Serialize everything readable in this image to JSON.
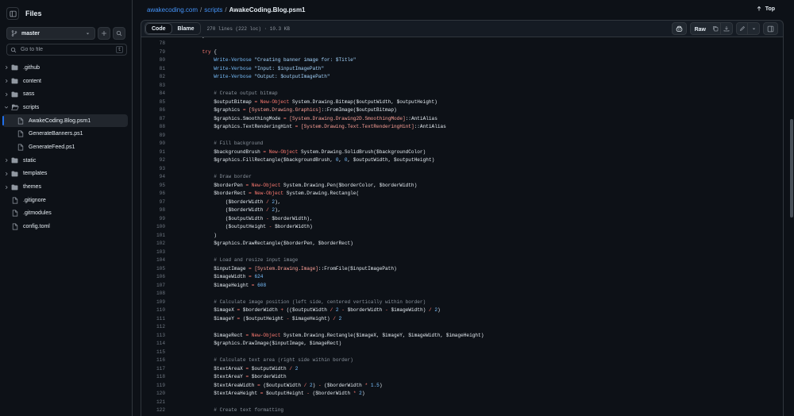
{
  "sidebar": {
    "title": "Files",
    "branch": "master",
    "search_placeholder": "Go to file",
    "search_shortcut": "t",
    "items": [
      {
        "label": ".github",
        "type": "folder"
      },
      {
        "label": "content",
        "type": "folder"
      },
      {
        "label": "sass",
        "type": "folder"
      },
      {
        "label": "scripts",
        "type": "folder-open"
      },
      {
        "label": "AwakeCoding.Blog.psm1",
        "type": "file-child",
        "active": true
      },
      {
        "label": "GenerateBanners.ps1",
        "type": "file-child"
      },
      {
        "label": "GenerateFeed.ps1",
        "type": "file-child"
      },
      {
        "label": "static",
        "type": "folder"
      },
      {
        "label": "templates",
        "type": "folder"
      },
      {
        "label": "themes",
        "type": "folder"
      },
      {
        "label": ".gitignore",
        "type": "file"
      },
      {
        "label": ".gitmodules",
        "type": "file"
      },
      {
        "label": "config.toml",
        "type": "file"
      }
    ]
  },
  "breadcrumb": {
    "repo": "awakecoding.com",
    "sep": "/",
    "folder": "scripts",
    "file": "AwakeCoding.Blog.psm1"
  },
  "top_label": "Top",
  "file_header": {
    "tabs": [
      "Code",
      "Blame"
    ],
    "meta": "270 lines (222 loc) · 10.3 KB",
    "raw_label": "Raw"
  },
  "code": {
    "first_line_number": 77,
    "lines": [
      [
        [
          "",
          "    }"
        ]
      ],
      [
        [
          "",
          ""
        ]
      ],
      [
        [
          "k",
          "    try "
        ],
        [
          "",
          "{"
        ]
      ],
      [
        [
          "f",
          "        Write-Verbose "
        ],
        [
          "s",
          "\"Creating banner image for: $Title\""
        ]
      ],
      [
        [
          "f",
          "        Write-Verbose "
        ],
        [
          "s",
          "\"Input: $inputImagePath\""
        ]
      ],
      [
        [
          "f",
          "        Write-Verbose "
        ],
        [
          "s",
          "\"Output: $outputImagePath\""
        ]
      ],
      [
        [
          "",
          ""
        ]
      ],
      [
        [
          "c",
          "        # Create output bitmap"
        ]
      ],
      [
        [
          "",
          "        $outputBitmap "
        ],
        [
          "k",
          "= New-Object "
        ],
        [
          "",
          "System.Drawing.Bitmap($outputWidth, $outputHeight)"
        ]
      ],
      [
        [
          "",
          "        $graphics "
        ],
        [
          "k",
          "= "
        ],
        [
          "t",
          "[System.Drawing.Graphics]"
        ],
        [
          "",
          "::FromImage($outputBitmap)"
        ]
      ],
      [
        [
          "",
          "        $graphics.SmoothingMode "
        ],
        [
          "k",
          "= "
        ],
        [
          "t",
          "[System.Drawing.Drawing2D.SmoothingMode]"
        ],
        [
          "",
          "::AntiAlias"
        ]
      ],
      [
        [
          "",
          "        $graphics.TextRenderingHint "
        ],
        [
          "k",
          "= "
        ],
        [
          "t",
          "[System.Drawing.Text.TextRenderingHint]"
        ],
        [
          "",
          "::AntiAlias"
        ]
      ],
      [
        [
          "",
          ""
        ]
      ],
      [
        [
          "c",
          "        # Fill background"
        ]
      ],
      [
        [
          "",
          "        $backgroundBrush "
        ],
        [
          "k",
          "= New-Object "
        ],
        [
          "",
          "System.Drawing.SolidBrush($backgroundColor)"
        ]
      ],
      [
        [
          "",
          "        $graphics.FillRectangle($backgroundBrush, "
        ],
        [
          "n",
          "0"
        ],
        [
          "",
          ", "
        ],
        [
          "n",
          "0"
        ],
        [
          "",
          ", $outputWidth, $outputHeight)"
        ]
      ],
      [
        [
          "",
          ""
        ]
      ],
      [
        [
          "c",
          "        # Draw border"
        ]
      ],
      [
        [
          "",
          "        $borderPen "
        ],
        [
          "k",
          "= New-Object "
        ],
        [
          "",
          "System.Drawing.Pen($borderColor, $borderWidth)"
        ]
      ],
      [
        [
          "",
          "        $borderRect "
        ],
        [
          "k",
          "= New-Object "
        ],
        [
          "",
          "System.Drawing.Rectangle("
        ]
      ],
      [
        [
          "",
          "            ($borderWidth "
        ],
        [
          "k",
          "/ "
        ],
        [
          "n",
          "2"
        ],
        [
          "",
          "),"
        ]
      ],
      [
        [
          "",
          "            ($borderWidth "
        ],
        [
          "k",
          "/ "
        ],
        [
          "n",
          "2"
        ],
        [
          "",
          "),"
        ]
      ],
      [
        [
          "",
          "            ($outputWidth "
        ],
        [
          "k",
          "- "
        ],
        [
          "",
          "$borderWidth),"
        ]
      ],
      [
        [
          "",
          "            ($outputHeight "
        ],
        [
          "k",
          "- "
        ],
        [
          "",
          "$borderWidth)"
        ]
      ],
      [
        [
          "",
          "        )"
        ]
      ],
      [
        [
          "",
          "        $graphics.DrawRectangle($borderPen, $borderRect)"
        ]
      ],
      [
        [
          "",
          ""
        ]
      ],
      [
        [
          "c",
          "        # Load and resize input image"
        ]
      ],
      [
        [
          "",
          "        $inputImage "
        ],
        [
          "k",
          "= "
        ],
        [
          "t",
          "[System.Drawing.Image]"
        ],
        [
          "",
          "::FromFile($inputImagePath)"
        ]
      ],
      [
        [
          "",
          "        $imageWidth "
        ],
        [
          "k",
          "= "
        ],
        [
          "n",
          "624"
        ]
      ],
      [
        [
          "",
          "        $imageHeight "
        ],
        [
          "k",
          "= "
        ],
        [
          "n",
          "608"
        ]
      ],
      [
        [
          "",
          ""
        ]
      ],
      [
        [
          "c",
          "        # Calculate image position (left side, centered vertically within border)"
        ]
      ],
      [
        [
          "",
          "        $imageX "
        ],
        [
          "k",
          "= "
        ],
        [
          "",
          "$borderWidth "
        ],
        [
          "k",
          "+ "
        ],
        [
          "",
          "(($outputWidth "
        ],
        [
          "k",
          "/ "
        ],
        [
          "n",
          "2 "
        ],
        [
          "k",
          "- "
        ],
        [
          "",
          "$borderWidth "
        ],
        [
          "k",
          "- "
        ],
        [
          "",
          "$imageWidth) "
        ],
        [
          "k",
          "/ "
        ],
        [
          "n",
          "2"
        ],
        [
          "",
          ")"
        ]
      ],
      [
        [
          "",
          "        $imageY "
        ],
        [
          "k",
          "= "
        ],
        [
          "",
          "($outputHeight "
        ],
        [
          "k",
          "- "
        ],
        [
          "",
          "$imageHeight) "
        ],
        [
          "k",
          "/ "
        ],
        [
          "n",
          "2"
        ]
      ],
      [
        [
          "",
          ""
        ]
      ],
      [
        [
          "",
          "        $imageRect "
        ],
        [
          "k",
          "= New-Object "
        ],
        [
          "",
          "System.Drawing.Rectangle($imageX, $imageY, $imageWidth, $imageHeight)"
        ]
      ],
      [
        [
          "",
          "        $graphics.DrawImage($inputImage, $imageRect)"
        ]
      ],
      [
        [
          "",
          ""
        ]
      ],
      [
        [
          "c",
          "        # Calculate text area (right side within border)"
        ]
      ],
      [
        [
          "",
          "        $textAreaX "
        ],
        [
          "k",
          "= "
        ],
        [
          "",
          "$outputWidth "
        ],
        [
          "k",
          "/ "
        ],
        [
          "n",
          "2"
        ]
      ],
      [
        [
          "",
          "        $textAreaY "
        ],
        [
          "k",
          "= "
        ],
        [
          "",
          "$borderWidth"
        ]
      ],
      [
        [
          "",
          "        $textAreaWidth "
        ],
        [
          "k",
          "= "
        ],
        [
          "",
          "($outputWidth "
        ],
        [
          "k",
          "/ "
        ],
        [
          "n",
          "2"
        ],
        [
          "",
          ") "
        ],
        [
          "k",
          "- "
        ],
        [
          "",
          "($borderWidth "
        ],
        [
          "k",
          "* "
        ],
        [
          "n",
          "1.5"
        ],
        [
          "",
          ")"
        ]
      ],
      [
        [
          "",
          "        $textAreaHeight "
        ],
        [
          "k",
          "= "
        ],
        [
          "",
          "$outputHeight "
        ],
        [
          "k",
          "- "
        ],
        [
          "",
          "($borderWidth "
        ],
        [
          "k",
          "* "
        ],
        [
          "n",
          "2"
        ],
        [
          "",
          ")"
        ]
      ],
      [
        [
          "",
          ""
        ]
      ],
      [
        [
          "c",
          "        # Create text formatting"
        ]
      ],
      [
        [
          "",
          ""
        ]
      ]
    ]
  },
  "colors": {
    "background": "#0d1117",
    "link": "#4493f8",
    "keyword": "#ff7b72",
    "comment": "#8b949e",
    "string": "#a5d6ff",
    "type": "#ffa198"
  }
}
